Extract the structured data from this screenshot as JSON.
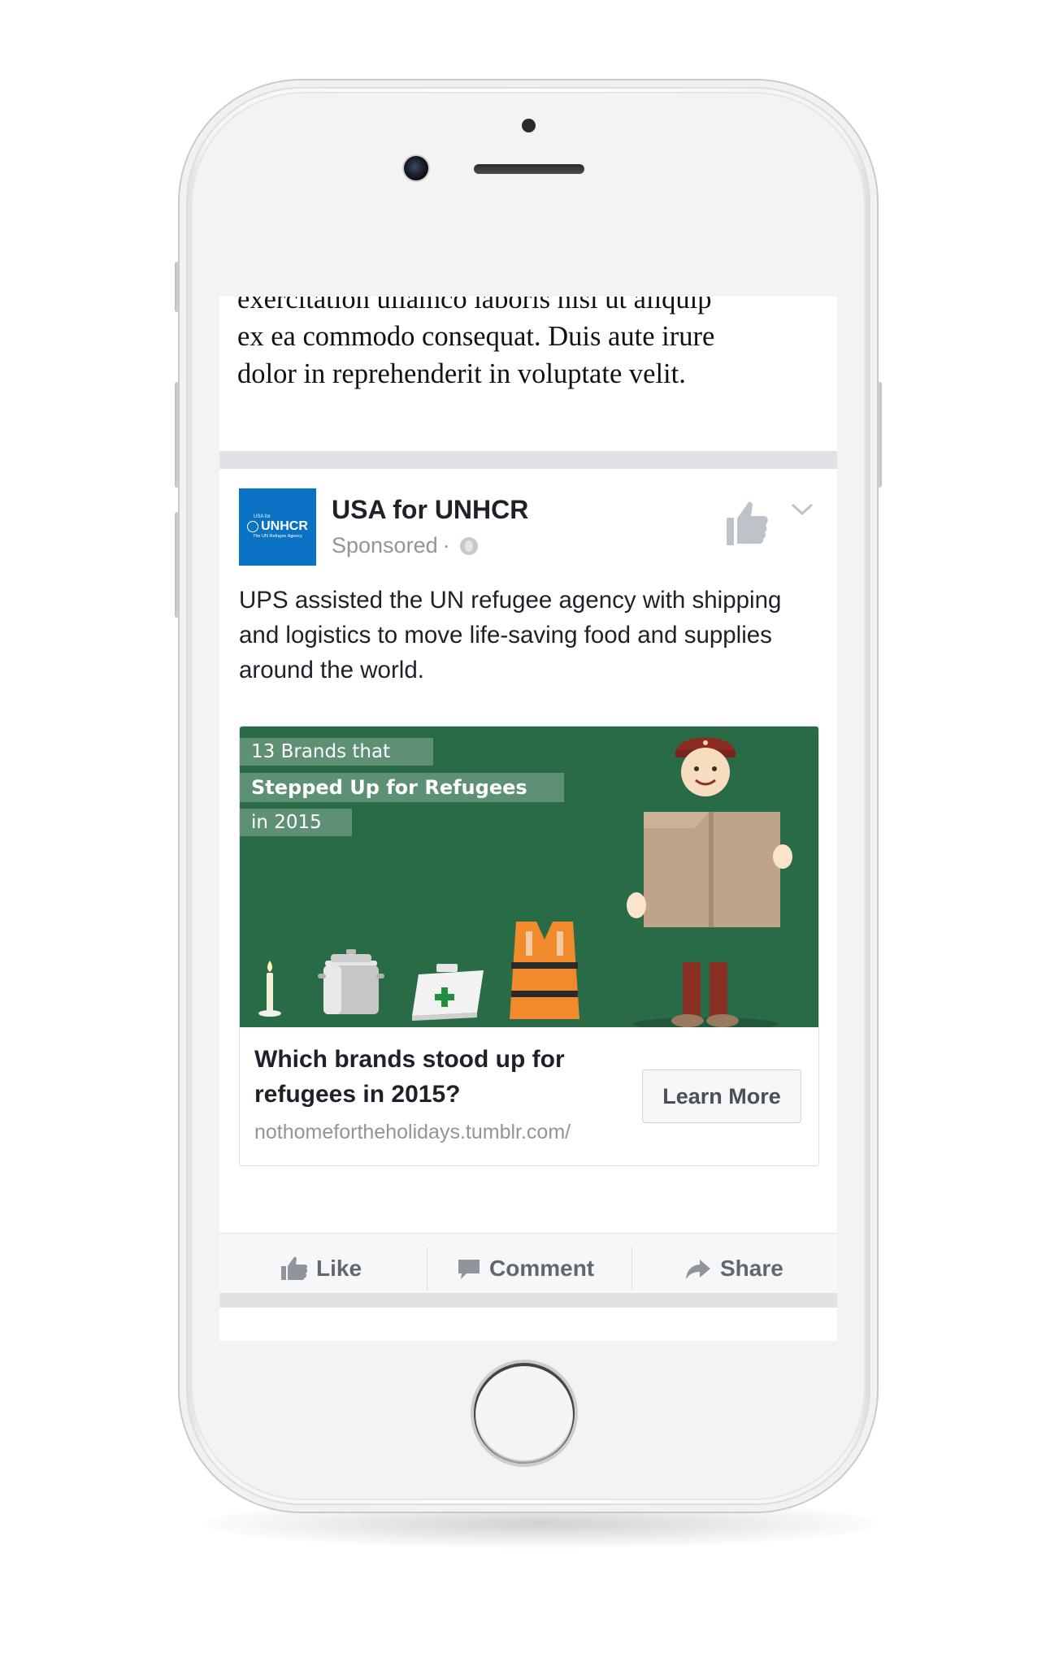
{
  "article": {
    "lines": [
      "exercitation ullamco laboris nisi ut aliquip",
      "ex ea commodo consequat. Duis aute irure",
      "dolor in reprehenderit in voluptate velit."
    ]
  },
  "post": {
    "page_name": "USA for UNHCR",
    "sponsored": "Sponsored",
    "separator": "·",
    "avatar": {
      "small": "USA for",
      "logo": "UNHCR",
      "tagline": "The UN Refugee Agency"
    },
    "text": "UPS assisted the UN refugee agency with shipping and logistics to move life-saving food and supplies around the world."
  },
  "ad": {
    "image_text": {
      "line1": "13 Brands that",
      "line2": "Stepped Up for Refugees",
      "line3": "in 2015"
    },
    "headline": "Which brands stood up for refugees in 2015?",
    "domain": "nothomefortheholidays.tumblr.com/",
    "cta": "Learn More"
  },
  "actions": {
    "like": "Like",
    "comment": "Comment",
    "share": "Share"
  },
  "colors": {
    "ad_background": "#296b47",
    "brand_blue": "#0a72c3",
    "icon_gray": "#90949c"
  }
}
